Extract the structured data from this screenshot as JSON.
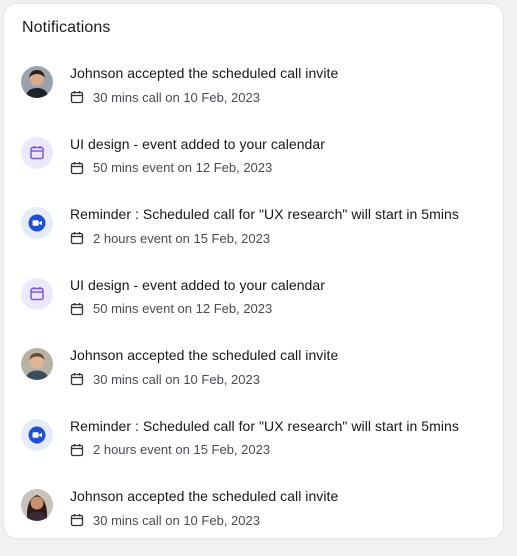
{
  "panel": {
    "title": "Notifications"
  },
  "notifications": [
    {
      "type": "avatar",
      "avatar": "person-avatar-1",
      "title": "Johnson accepted the scheduled call invite",
      "meta": "30 mins call on 10 Feb, 2023",
      "meta_icon": "calendar-icon"
    },
    {
      "type": "calendar",
      "icon": "calendar-icon",
      "title": "UI design - event added to your calendar",
      "meta": "50 mins event on 12 Feb, 2023",
      "meta_icon": "calendar-icon"
    },
    {
      "type": "video",
      "icon": "video-camera-icon",
      "title": "Reminder : Scheduled call for \"UX research\" will start in 5mins",
      "meta": "2 hours event on 15 Feb, 2023",
      "meta_icon": "calendar-icon"
    },
    {
      "type": "calendar",
      "icon": "calendar-icon",
      "title": "UI design - event added to your calendar",
      "meta": "50 mins event on 12 Feb, 2023",
      "meta_icon": "calendar-icon"
    },
    {
      "type": "avatar",
      "avatar": "person-avatar-2",
      "title": "Johnson accepted the scheduled call invite",
      "meta": "30 mins call on 10 Feb, 2023",
      "meta_icon": "calendar-icon"
    },
    {
      "type": "video",
      "icon": "video-camera-icon",
      "title": "Reminder : Scheduled call for \"UX research\" will start in 5mins",
      "meta": "2 hours event on 15 Feb, 2023",
      "meta_icon": "calendar-icon"
    },
    {
      "type": "avatar",
      "avatar": "person-avatar-3",
      "title": "Johnson accepted the scheduled call invite",
      "meta": "30 mins call on 10 Feb, 2023",
      "meta_icon": "calendar-icon"
    }
  ],
  "colors": {
    "calendar_badge_bg": "#ece8fb",
    "calendar_badge_fg": "#7b5ad9",
    "video_badge_bg": "#e6ebf8",
    "video_badge_fg": "#1f4fd6"
  }
}
